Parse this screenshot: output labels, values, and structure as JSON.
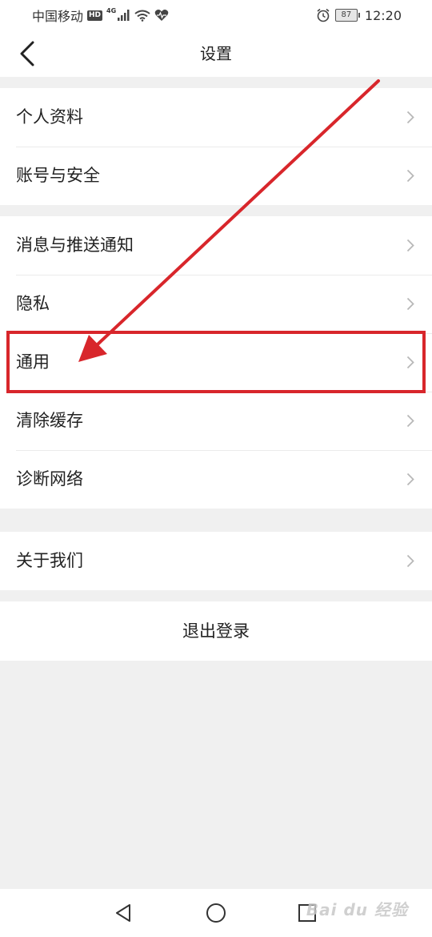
{
  "status_bar": {
    "carrier": "中国移动",
    "hd_badge": "HD",
    "network_type": "4G",
    "battery_level": "87",
    "time": "12:20"
  },
  "header": {
    "title": "设置"
  },
  "groups": [
    {
      "items": [
        {
          "label": "个人资料"
        },
        {
          "label": "账号与安全"
        }
      ]
    },
    {
      "items": [
        {
          "label": "消息与推送通知"
        },
        {
          "label": "隐私"
        },
        {
          "label": "通用"
        },
        {
          "label": "清除缓存"
        },
        {
          "label": "诊断网络"
        }
      ]
    },
    {
      "items": [
        {
          "label": "关于我们"
        }
      ]
    }
  ],
  "logout": {
    "label": "退出登录"
  },
  "annotation": {
    "highlighted_item": "通用",
    "color": "#d8262b"
  },
  "watermark": {
    "text": "Bai du 经验"
  },
  "colors": {
    "background": "#f0f0f0",
    "surface": "#ffffff",
    "text": "#222222",
    "chevron": "#b8b8b8"
  }
}
